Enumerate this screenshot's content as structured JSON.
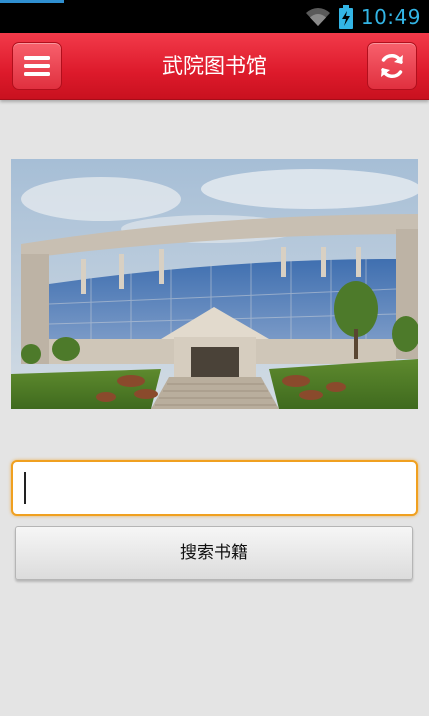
{
  "status_bar": {
    "time": "10:49",
    "icons": [
      "wifi-icon",
      "battery-charging-icon"
    ],
    "clock_color": "#33b5e5"
  },
  "app_bar": {
    "title": "武院图书馆",
    "menu_icon": "menu-icon",
    "refresh_icon": "refresh-icon",
    "background_color": "#dd1a2b"
  },
  "hero_image": {
    "subject": "library-building-photo"
  },
  "search": {
    "input_value": "",
    "placeholder": "",
    "button_label": "搜索书籍",
    "focus_color": "#f0a020"
  }
}
